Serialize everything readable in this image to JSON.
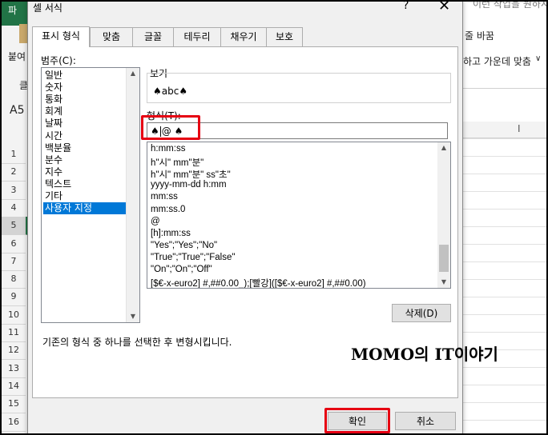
{
  "excel": {
    "top_left_char": "파",
    "side_labels": [
      "붙여",
      "클"
    ],
    "name_box": "A5",
    "row_numbers": [
      "1",
      "2",
      "3",
      "4",
      "5",
      "6",
      "7",
      "8",
      "9",
      "10",
      "11",
      "12",
      "13",
      "14",
      "15",
      "16"
    ],
    "selected_row": "5",
    "right_top_text": "이런 작업을 원하시",
    "right_wrap_text": "줄 바꿈",
    "right_merge_text": "하고 가운데 맞춤",
    "right_dropdown": "∨",
    "right_col_mark": "I"
  },
  "dialog": {
    "title": "셀 서식",
    "help": "?",
    "close": "✕",
    "tabs": [
      "표시 형식",
      "맞춤",
      "글꼴",
      "테두리",
      "채우기",
      "보호"
    ],
    "active_tab": "표시 형식",
    "category_label": "범주(C):",
    "categories": [
      "일반",
      "숫자",
      "통화",
      "회계",
      "날짜",
      "시간",
      "백분율",
      "분수",
      "지수",
      "텍스트",
      "기타",
      "사용자 지정"
    ],
    "selected_category": "사용자 지정",
    "sample_label": "보기",
    "sample_value": "♠abc♠",
    "format_label": "형식(T):",
    "format_value_left": "♠",
    "format_value_right": "@ ♠",
    "format_list": [
      "h:mm:ss",
      "h\"시\" mm\"분\"",
      "h\"시\" mm\"분\" ss\"초\"",
      "yyyy-mm-dd h:mm",
      "mm:ss",
      "mm:ss.0",
      "@",
      "[h]:mm:ss",
      "\"Yes\";\"Yes\";\"No\"",
      "\"True\";\"True\";\"False\"",
      "\"On\";\"On\";\"Off\"",
      "[$€-x-euro2] #,##0.00_);[빨강]([$€-x-euro2] #,##0.00)"
    ],
    "delete_button": "삭제(D)",
    "description": "기존의 형식 중 하나를 선택한 후 변형시킵니다.",
    "ok_button": "확인",
    "cancel_button": "취소"
  },
  "watermark": "MOMO의 IT이야기",
  "colors": {
    "highlight_red": "#e60012",
    "selection_blue": "#0078d7",
    "excel_green": "#217346"
  }
}
